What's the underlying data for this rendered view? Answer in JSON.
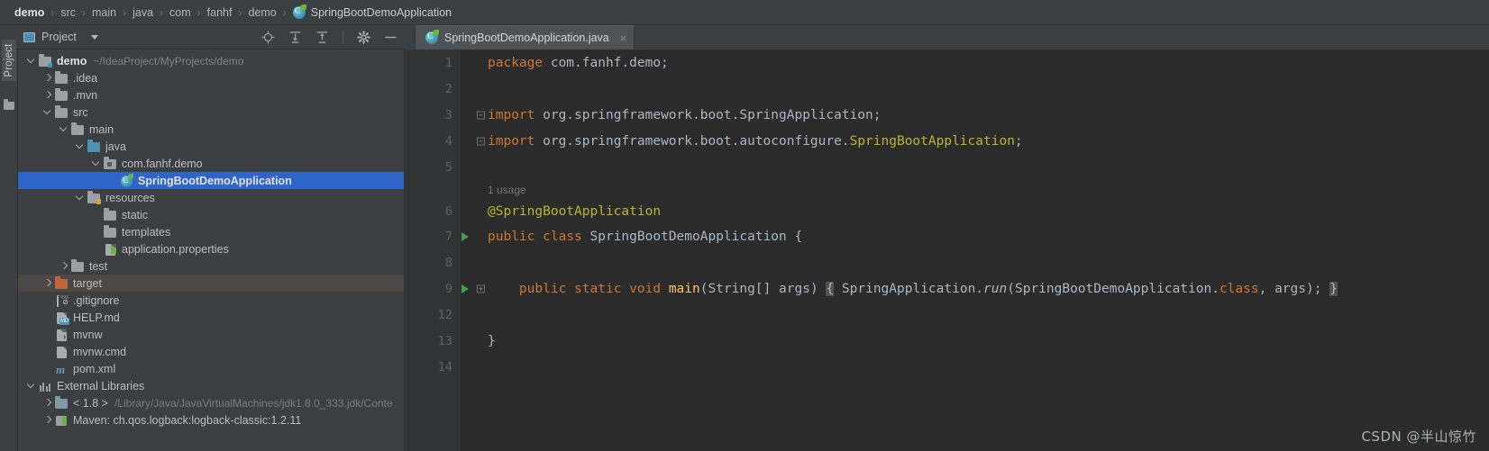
{
  "breadcrumb": {
    "items": [
      "demo",
      "src",
      "main",
      "java",
      "com",
      "fanhf",
      "demo"
    ],
    "leaf": "SpringBootDemoApplication",
    "separator": "›"
  },
  "toolbar": {
    "project_label": "Project",
    "icons": [
      "locate-icon",
      "expand-all-icon",
      "collapse-all-icon",
      "settings-gear-icon",
      "hide-icon"
    ]
  },
  "stripe": {
    "label": "Project"
  },
  "tab": {
    "title": "SpringBootDemoApplication.java",
    "close_label": "×"
  },
  "tree": {
    "rows": [
      {
        "indent": 0,
        "arrow": "open",
        "icon": "module-folder-icon",
        "label": "demo",
        "bold": true,
        "sub": "~/IdeaProject/MyProjects/demo",
        "state": "normal"
      },
      {
        "indent": 1,
        "arrow": "closed",
        "icon": "folder-icon",
        "label": ".idea",
        "bold": false,
        "sub": "",
        "state": "normal"
      },
      {
        "indent": 1,
        "arrow": "closed",
        "icon": "folder-icon",
        "label": ".mvn",
        "bold": false,
        "sub": "",
        "state": "normal"
      },
      {
        "indent": 1,
        "arrow": "open",
        "icon": "folder-icon",
        "label": "src",
        "bold": false,
        "sub": "",
        "state": "normal"
      },
      {
        "indent": 2,
        "arrow": "open",
        "icon": "folder-icon",
        "label": "main",
        "bold": false,
        "sub": "",
        "state": "normal"
      },
      {
        "indent": 3,
        "arrow": "open",
        "icon": "source-root-icon",
        "label": "java",
        "bold": false,
        "sub": "",
        "state": "normal"
      },
      {
        "indent": 4,
        "arrow": "open",
        "icon": "package-icon",
        "label": "com.fanhf.demo",
        "bold": false,
        "sub": "",
        "state": "normal"
      },
      {
        "indent": 5,
        "arrow": "none",
        "icon": "spring-class-icon",
        "label": "SpringBootDemoApplication",
        "bold": true,
        "sub": "",
        "state": "selected"
      },
      {
        "indent": 3,
        "arrow": "open",
        "icon": "resources-root-icon",
        "label": "resources",
        "bold": false,
        "sub": "",
        "state": "normal"
      },
      {
        "indent": 4,
        "arrow": "none",
        "icon": "folder-icon",
        "label": "static",
        "bold": false,
        "sub": "",
        "state": "normal"
      },
      {
        "indent": 4,
        "arrow": "none",
        "icon": "folder-icon",
        "label": "templates",
        "bold": false,
        "sub": "",
        "state": "normal"
      },
      {
        "indent": 4,
        "arrow": "none",
        "icon": "properties-file-icon",
        "label": "application.properties",
        "bold": false,
        "sub": "",
        "state": "normal"
      },
      {
        "indent": 2,
        "arrow": "closed",
        "icon": "folder-icon",
        "label": "test",
        "bold": false,
        "sub": "",
        "state": "normal"
      },
      {
        "indent": 1,
        "arrow": "closed",
        "icon": "excluded-folder-icon",
        "label": "target",
        "bold": false,
        "sub": "",
        "state": "hover"
      },
      {
        "indent": 1,
        "arrow": "none",
        "icon": "gitignore-file-icon",
        "label": ".gitignore",
        "bold": false,
        "sub": "",
        "state": "normal"
      },
      {
        "indent": 1,
        "arrow": "none",
        "icon": "markdown-file-icon",
        "label": "HELP.md",
        "bold": false,
        "sub": "",
        "state": "normal"
      },
      {
        "indent": 1,
        "arrow": "none",
        "icon": "shell-file-icon",
        "label": "mvnw",
        "bold": false,
        "sub": "",
        "state": "normal"
      },
      {
        "indent": 1,
        "arrow": "none",
        "icon": "cmd-file-icon",
        "label": "mvnw.cmd",
        "bold": false,
        "sub": "",
        "state": "normal"
      },
      {
        "indent": 1,
        "arrow": "none",
        "icon": "maven-file-icon",
        "label": "pom.xml",
        "bold": false,
        "sub": "",
        "state": "normal"
      },
      {
        "indent": 0,
        "arrow": "open",
        "icon": "external-libraries-icon",
        "label": "External Libraries",
        "bold": false,
        "sub": "",
        "state": "normal"
      },
      {
        "indent": 1,
        "arrow": "closed",
        "icon": "jdk-icon",
        "label": "< 1.8 >",
        "bold": false,
        "sub": "/Library/Java/JavaVirtualMachines/jdk1.8.0_333.jdk/Conte",
        "state": "normal"
      },
      {
        "indent": 1,
        "arrow": "closed",
        "icon": "library-icon",
        "label": "Maven: ch.qos.logback:logback-classic:1.2.11",
        "bold": false,
        "sub": "",
        "state": "normal"
      }
    ]
  },
  "editor": {
    "inlay_hint": "1 usage",
    "lines": [
      {
        "num": "1",
        "run": false,
        "fold": "none"
      },
      {
        "num": "2",
        "run": false,
        "fold": "none"
      },
      {
        "num": "3",
        "run": false,
        "fold": "minus"
      },
      {
        "num": "4",
        "run": false,
        "fold": "minus"
      },
      {
        "num": "5",
        "run": false,
        "fold": "none"
      },
      {
        "num": "6",
        "run": false,
        "fold": "none"
      },
      {
        "num": "7",
        "run": true,
        "fold": "none"
      },
      {
        "num": "8",
        "run": false,
        "fold": "none"
      },
      {
        "num": "9",
        "run": true,
        "fold": "plus"
      },
      {
        "num": "12",
        "run": false,
        "fold": "none"
      },
      {
        "num": "13",
        "run": false,
        "fold": "none"
      },
      {
        "num": "14",
        "run": false,
        "fold": "none"
      }
    ],
    "code": {
      "l1_kw": "package",
      "l1_rest": " com.fanhf.demo;",
      "l3_kw": "import",
      "l3_rest": " org.springframework.boot.SpringApplication;",
      "l4_kw": "import",
      "l4_mid": " org.springframework.boot.autoconfigure.",
      "l4_cls": "SpringBootApplication",
      "l4_end": ";",
      "l6_ann": "@SpringBootApplication",
      "l7_kw1": "public",
      "l7_kw2": "class",
      "l7_name": "SpringBootDemoApplication",
      "l7_brace": "{",
      "l9_kw1": "public",
      "l9_kw2": "static",
      "l9_kw3": "void",
      "l9_fn": "main",
      "l9_params": "(String[] args)",
      "l9_open": "{",
      "l9_call_obj": "SpringApplication.",
      "l9_call_fn": "run",
      "l9_arg1": "(SpringBootDemoApplication.",
      "l9_class_kw": "class",
      "l9_arg2": ", args)",
      "l9_semi": ";",
      "l9_close": "}",
      "l13_brace": "}"
    }
  },
  "watermark": {
    "text": "CSDN @半山惊竹"
  },
  "colors": {
    "panel_bg": "#3c3f41",
    "editor_bg": "#2b2b2b",
    "gutter_bg": "#313335",
    "selection_blue": "#2f65c9",
    "keyword_orange": "#cc7832",
    "annotation_yellow": "#bbb529",
    "identifier": "#a9b7c6",
    "method_yellow": "#ffc66d",
    "run_green": "#499c54",
    "hover_row": "#4b4845"
  }
}
